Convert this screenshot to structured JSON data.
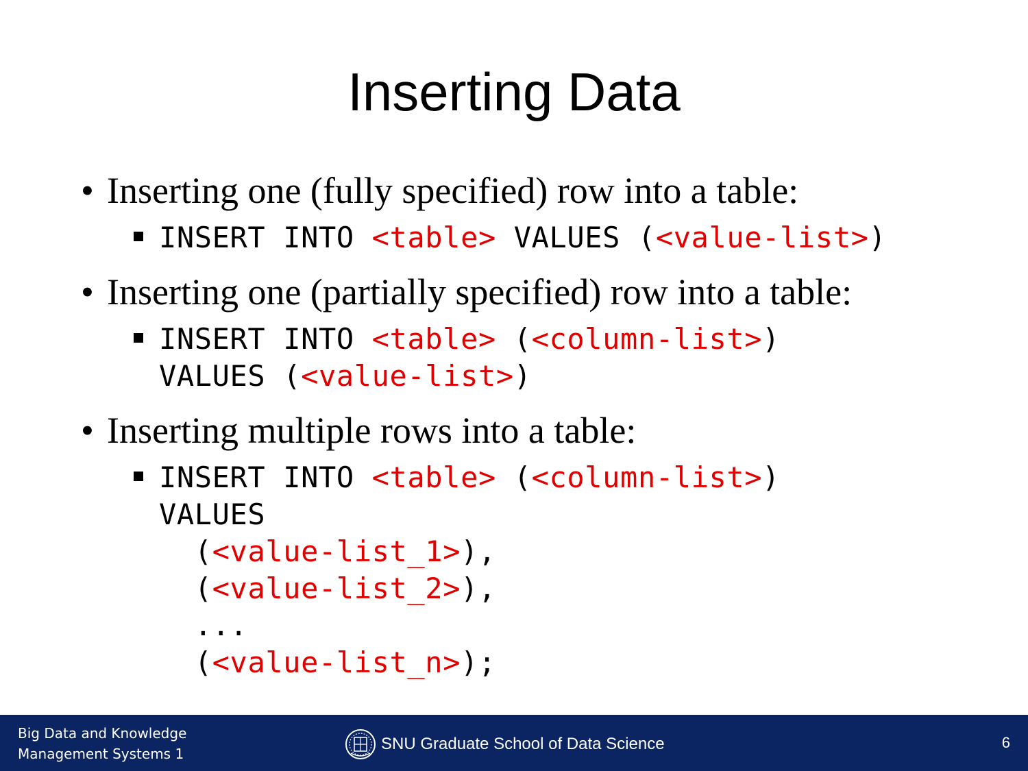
{
  "title": "Inserting Data",
  "bullets": [
    {
      "text": "Inserting one (fully specified) row into a table:",
      "code": [
        [
          {
            "t": "INSERT INTO ",
            "c": "kw"
          },
          {
            "t": "<table>",
            "c": "ph"
          },
          {
            "t": " VALUES (",
            "c": "kw"
          },
          {
            "t": "<value-list>",
            "c": "ph"
          },
          {
            "t": ")",
            "c": "kw"
          }
        ]
      ]
    },
    {
      "text": "Inserting one (partially specified) row into a table:",
      "code": [
        [
          {
            "t": "INSERT INTO ",
            "c": "kw"
          },
          {
            "t": "<table>",
            "c": "ph"
          },
          {
            "t": " (",
            "c": "kw"
          },
          {
            "t": "<column-list>",
            "c": "ph"
          },
          {
            "t": ")",
            "c": "kw"
          }
        ],
        [
          {
            "t": "VALUES (",
            "c": "kw"
          },
          {
            "t": "<value-list>",
            "c": "ph"
          },
          {
            "t": ")",
            "c": "kw"
          }
        ]
      ]
    },
    {
      "text": "Inserting multiple rows into a table:",
      "code": [
        [
          {
            "t": "INSERT INTO ",
            "c": "kw"
          },
          {
            "t": "<table>",
            "c": "ph"
          },
          {
            "t": " (",
            "c": "kw"
          },
          {
            "t": "<column-list>",
            "c": "ph"
          },
          {
            "t": ")",
            "c": "kw"
          }
        ],
        [
          {
            "t": "VALUES",
            "c": "kw"
          }
        ],
        [
          {
            "t": "  (",
            "c": "kw"
          },
          {
            "t": "<value-list_1>",
            "c": "ph"
          },
          {
            "t": "),",
            "c": "kw"
          }
        ],
        [
          {
            "t": "  (",
            "c": "kw"
          },
          {
            "t": "<value-list_2>",
            "c": "ph"
          },
          {
            "t": "),",
            "c": "kw"
          }
        ],
        [
          {
            "t": "  ...",
            "c": "kw"
          }
        ],
        [
          {
            "t": "  (",
            "c": "kw"
          },
          {
            "t": "<value-list_n>",
            "c": "ph"
          },
          {
            "t": ");",
            "c": "kw"
          }
        ]
      ]
    }
  ],
  "footer": {
    "course_line1": "Big Data and Knowledge",
    "course_line2": "Management Systems 1",
    "school": "SNU Graduate School of Data Science",
    "page_number": "6"
  },
  "colors": {
    "placeholder": "#e00000",
    "footer_bg": "#0b2563"
  },
  "icons": {
    "footer_logo": "snu-seal-icon"
  }
}
